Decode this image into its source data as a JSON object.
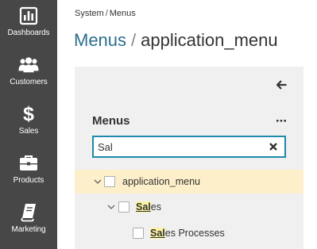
{
  "sidebar": {
    "items": [
      {
        "label": "Dashboards",
        "icon": "dashboard-icon"
      },
      {
        "label": "Customers",
        "icon": "customers-icon"
      },
      {
        "label": "Sales",
        "icon": "dollar-icon"
      },
      {
        "label": "Products",
        "icon": "briefcase-icon"
      },
      {
        "label": "Marketing",
        "icon": "book-icon"
      }
    ]
  },
  "breadcrumb": {
    "root": "System",
    "separator": "/",
    "current": "Menus"
  },
  "page": {
    "parent": "Menus",
    "separator": "/",
    "title": "application_menu"
  },
  "panel": {
    "title": "Menus",
    "search": {
      "value": "Sal"
    },
    "tree": [
      {
        "label": "application_menu",
        "selected": true,
        "expanded": true
      },
      {
        "match": "Sal",
        "rest": "es",
        "expanded": true
      },
      {
        "match": "Sal",
        "rest": "es Processes"
      }
    ]
  },
  "colors": {
    "sidebar_bg": "#474747",
    "accent": "#1c8aa8",
    "title_link": "#2b6f8c",
    "selected_row": "#fdefc9",
    "highlight": "#fdf3a5"
  }
}
